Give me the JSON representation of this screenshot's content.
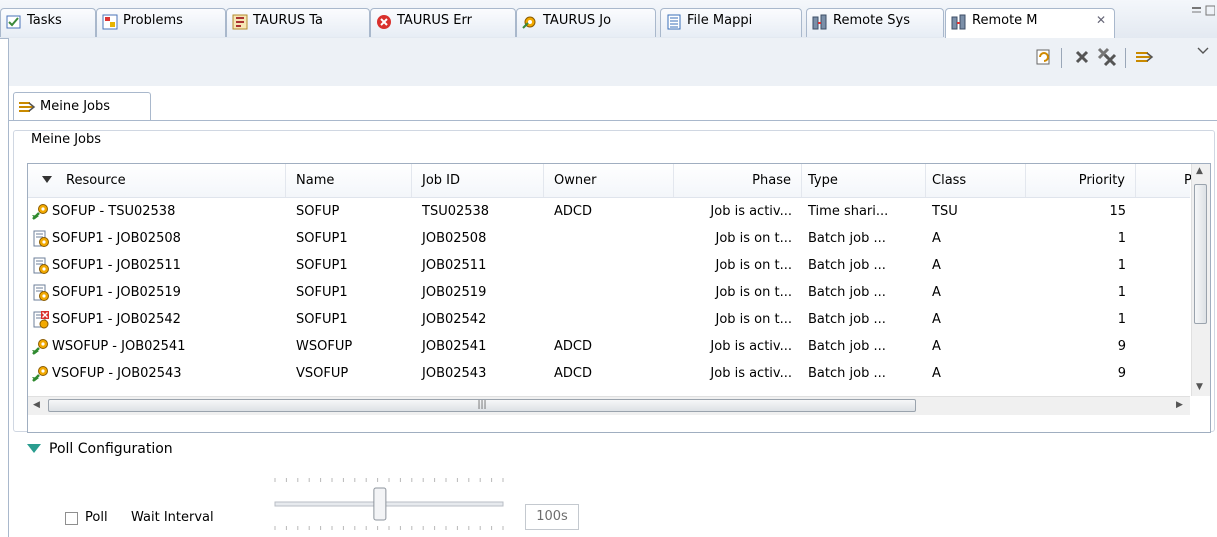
{
  "view_tabs": [
    {
      "label": "Tasks",
      "icon": "tasks-icon"
    },
    {
      "label": "Problems",
      "icon": "problems-icon"
    },
    {
      "label": "TAURUS Ta",
      "icon": "taurus-tasks-icon"
    },
    {
      "label": "TAURUS Err",
      "icon": "taurus-errors-icon"
    },
    {
      "label": "TAURUS Jo",
      "icon": "taurus-jobs-icon"
    },
    {
      "label": "File Mappi",
      "icon": "file-mapping-icon"
    },
    {
      "label": "Remote Sys",
      "icon": "remote-systems-icon"
    },
    {
      "label": "Remote M",
      "icon": "remote-monitor-icon",
      "active": true,
      "close": "✕"
    }
  ],
  "toolbar": {
    "refresh_icon": "refresh-icon",
    "remove_icon": "remove-icon",
    "remove_all_icon": "remove-all-icon",
    "jobs_icon": "jobs-icon",
    "view_menu_icon": "view-menu-icon"
  },
  "subtab": {
    "label": "Meine Jobs"
  },
  "group": {
    "title": "Meine Jobs"
  },
  "table": {
    "columns": [
      "Resource",
      "Name",
      "Job ID",
      "Owner",
      "Phase",
      "Type",
      "Class",
      "Priority",
      "P"
    ],
    "rows": [
      {
        "icon": "job-active-icon",
        "resource": "SOFUP - TSU02538",
        "name": "SOFUP",
        "job_id": "TSU02538",
        "owner": "ADCD",
        "phase": "Job is activ...",
        "type": "Time shari...",
        "class": "TSU",
        "priority": "15"
      },
      {
        "icon": "job-queued-icon",
        "resource": "SOFUP1 - JOB02508",
        "name": "SOFUP1",
        "job_id": "JOB02508",
        "owner": "",
        "phase": "Job is on t...",
        "type": "Batch job ...",
        "class": "A",
        "priority": "1"
      },
      {
        "icon": "job-queued-icon",
        "resource": "SOFUP1 - JOB02511",
        "name": "SOFUP1",
        "job_id": "JOB02511",
        "owner": "",
        "phase": "Job is on t...",
        "type": "Batch job ...",
        "class": "A",
        "priority": "1"
      },
      {
        "icon": "job-queued-icon",
        "resource": "SOFUP1 - JOB02519",
        "name": "SOFUP1",
        "job_id": "JOB02519",
        "owner": "",
        "phase": "Job is on t...",
        "type": "Batch job ...",
        "class": "A",
        "priority": "1"
      },
      {
        "icon": "job-error-icon",
        "resource": "SOFUP1 - JOB02542",
        "name": "SOFUP1",
        "job_id": "JOB02542",
        "owner": "",
        "phase": "Job is on t...",
        "type": "Batch job ...",
        "class": "A",
        "priority": "1"
      },
      {
        "icon": "job-active-icon",
        "resource": "WSOFUP - JOB02541",
        "name": "WSOFUP",
        "job_id": "JOB02541",
        "owner": "ADCD",
        "phase": "Job is activ...",
        "type": "Batch job ...",
        "class": "A",
        "priority": "9"
      },
      {
        "icon": "job-active-icon",
        "resource": "VSOFUP - JOB02543",
        "name": "VSOFUP",
        "job_id": "JOB02543",
        "owner": "ADCD",
        "phase": "Job is activ...",
        "type": "Batch job ...",
        "class": "A",
        "priority": "9"
      }
    ]
  },
  "poll": {
    "section_title": "Poll Configuration",
    "checkbox_label": "Poll",
    "checked": false,
    "wait_label": "Wait Interval",
    "wait_value": "100s",
    "slider_fraction": 0.46
  },
  "colors": {
    "accent": "#2a9d8f",
    "tab_border": "#a9b8cc"
  }
}
